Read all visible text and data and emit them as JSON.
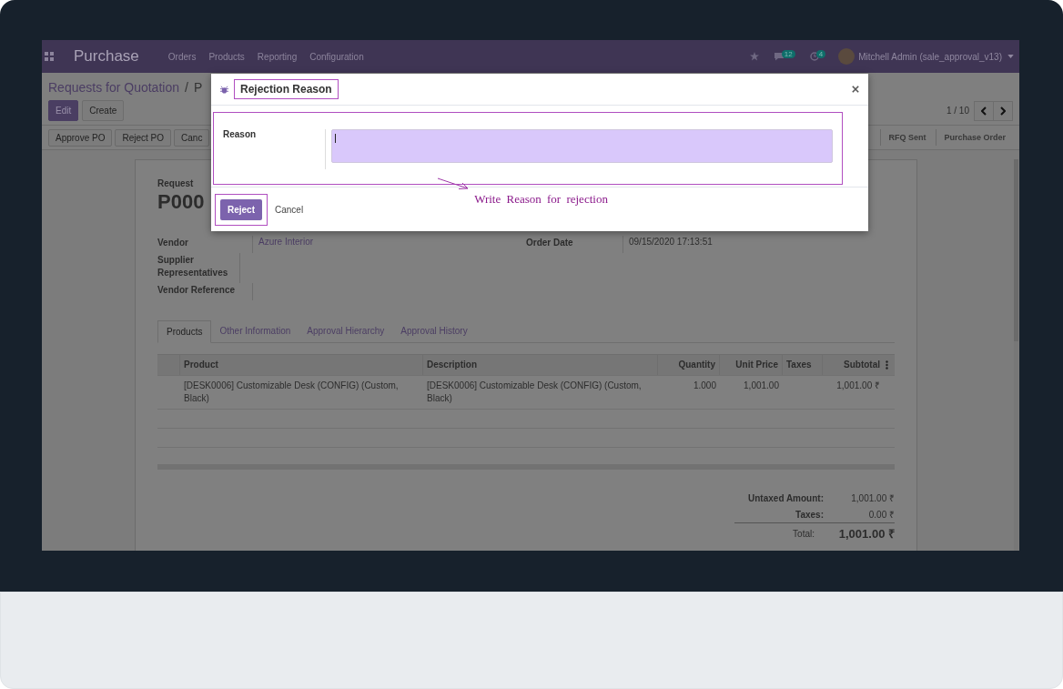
{
  "navbar": {
    "app_name": "Purchase",
    "menu": [
      "Orders",
      "Products",
      "Reporting",
      "Configuration"
    ],
    "badges": [
      {
        "kind": "chat",
        "count": "12"
      },
      {
        "kind": "activity",
        "count": "4"
      }
    ],
    "user": "Mitchell Admin (sale_approval_v13)"
  },
  "breadcrumb": [
    "Requests for Quotation",
    "/",
    "P"
  ],
  "buttons": [
    "Edit",
    "Create"
  ],
  "pager": "1 / 10",
  "actions": [
    "Approve PO",
    "Reject PO",
    "Canc"
  ],
  "stages": [
    "RFQ Sent",
    "Purchase Order"
  ],
  "form": {
    "subtitle": "Request",
    "name": "P000",
    "left_fields": [
      {
        "label": "Vendor",
        "value": "Azure Interior"
      },
      {
        "label": "Supplier Representatives"
      },
      {
        "label": "Vendor Reference"
      }
    ],
    "right_fields": [
      {
        "label": "Order Date",
        "value": "09/15/2020 17:13:51"
      }
    ],
    "tabs": [
      {
        "label": "Products",
        "selected": true
      },
      {
        "label": "Other Information",
        "selected": false
      },
      {
        "label": "Approval Hierarchy",
        "selected": false
      },
      {
        "label": "Approval History",
        "selected": false
      }
    ],
    "table": {
      "columns": [
        "Product",
        "Description",
        "Quantity",
        "Unit Price",
        "Taxes",
        "Subtotal"
      ],
      "rows": [
        [
          "[DESK0006] Customizable Desk (CONFIG) (Custom, Black)",
          "[DESK0006] Customizable Desk (CONFIG) (Custom, Black)",
          "1.000",
          "1,001.00",
          "",
          "1,001.00 ₹"
        ]
      ]
    },
    "totals": [
      {
        "kind": "line",
        "label": "Untaxed Amount:",
        "value": "1,001.00 ₹"
      },
      {
        "kind": "line",
        "label": "Taxes:",
        "value": "0.00 ₹"
      },
      {
        "kind": "total",
        "label": "Total:",
        "value": "1,001.00 ₹"
      }
    ]
  },
  "dialog": {
    "title": "Rejection Reason",
    "field_label": "Reason",
    "buttons": [
      "Reject",
      "Cancel"
    ],
    "annotation": "Write Reason for rejection"
  }
}
